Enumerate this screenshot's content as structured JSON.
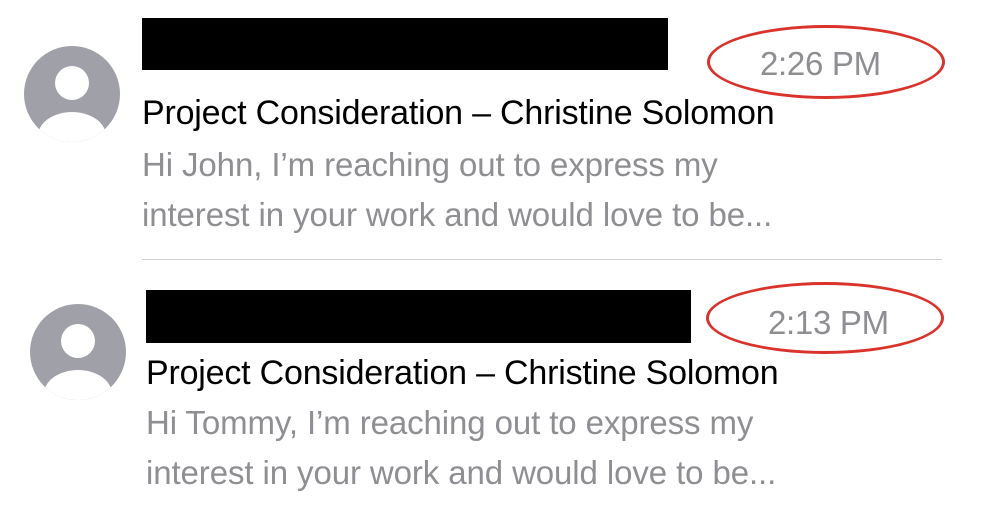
{
  "messages": [
    {
      "time": "2:26 PM",
      "subject": "Project Consideration – Christine Solomon",
      "preview_line1": "Hi John, I’m reaching out to express my",
      "preview_line2": "interest in your work and would love to be..."
    },
    {
      "time": "2:13 PM",
      "subject": "Project Consideration – Christine Solomon",
      "preview_line1": "Hi Tommy, I’m reaching out to express my",
      "preview_line2": "interest in your work and would love to be..."
    }
  ],
  "icons": {
    "avatar": "person-placeholder-icon"
  },
  "colors": {
    "avatar": "#a0a0a8",
    "secondary_text": "#8e8e93",
    "annotation": "#d9332b",
    "redaction": "#000000"
  }
}
